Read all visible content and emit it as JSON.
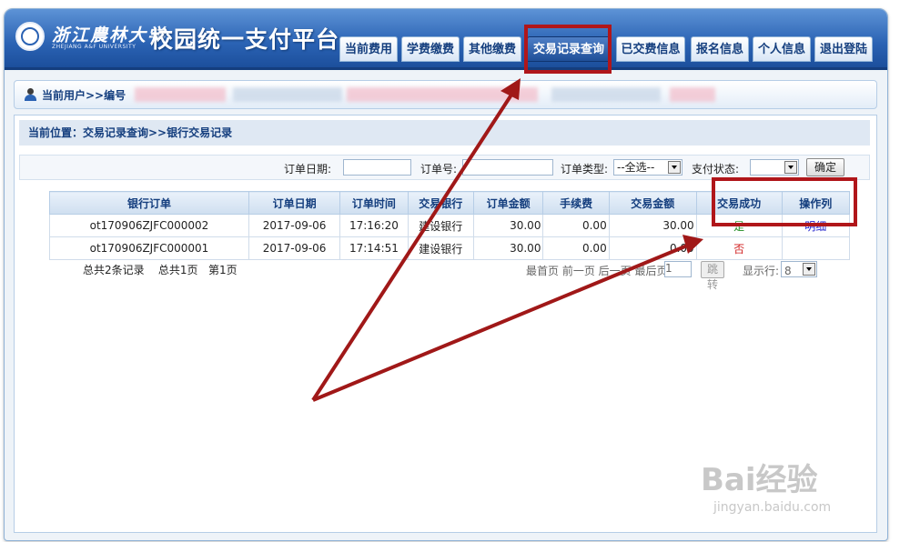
{
  "header": {
    "school_name_cn": "浙江農林大学",
    "school_name_en": "ZHEJIANG A&F UNIVERSITY",
    "title": "校园统一支付平台",
    "nav": [
      {
        "label": "当前费用"
      },
      {
        "label": "学费缴费"
      },
      {
        "label": "其他缴费"
      },
      {
        "label": "交易记录查询"
      },
      {
        "label": "已交费信息"
      },
      {
        "label": "报名信息"
      },
      {
        "label": "个人信息"
      },
      {
        "label": "退出登陆"
      }
    ],
    "active_tab": "交易记录查询"
  },
  "user": {
    "label": "当前用户>>编号"
  },
  "breadcrumb": "当前位置：交易记录查询>>银行交易记录",
  "filter": {
    "order_date_label": "订单日期:",
    "order_date_value": "",
    "order_no_label": "订单号:",
    "order_no_value": "",
    "order_type_label": "订单类型:",
    "order_type_value": "--全选--",
    "pay_status_label": "支付状态:",
    "pay_status_value": "",
    "confirm": "确定"
  },
  "table": {
    "columns": [
      "银行订单",
      "订单日期",
      "订单时间",
      "交易银行",
      "订单金额",
      "手续费",
      "交易金额",
      "交易成功",
      "操作列"
    ],
    "rows": [
      {
        "order": "ot170906ZJFC000002",
        "date": "2017-09-06",
        "time": "17:16:20",
        "bank": "建设银行",
        "amount": "30.00",
        "fee": "0.00",
        "trade_amount": "30.00",
        "success": "是",
        "action": "明细"
      },
      {
        "order": "ot170906ZJFC000001",
        "date": "2017-09-06",
        "time": "17:14:51",
        "bank": "建设银行",
        "amount": "30.00",
        "fee": "0.00",
        "trade_amount": "0.00",
        "success": "否",
        "action": ""
      }
    ]
  },
  "summary": {
    "records": "总共2条记录",
    "pages": "总共1页",
    "current": "第1页"
  },
  "pager": {
    "links": "最首页 前一页 后一页 最后页",
    "page_input": "1",
    "jump": "跳转",
    "rows_label": "显示行:",
    "rows_value": "8"
  },
  "watermark": {
    "brand": "Bai经验",
    "url": "jingyan.baidu.com"
  },
  "annotation_colors": {
    "highlight": "#b0161a",
    "arrow": "#a01818"
  }
}
